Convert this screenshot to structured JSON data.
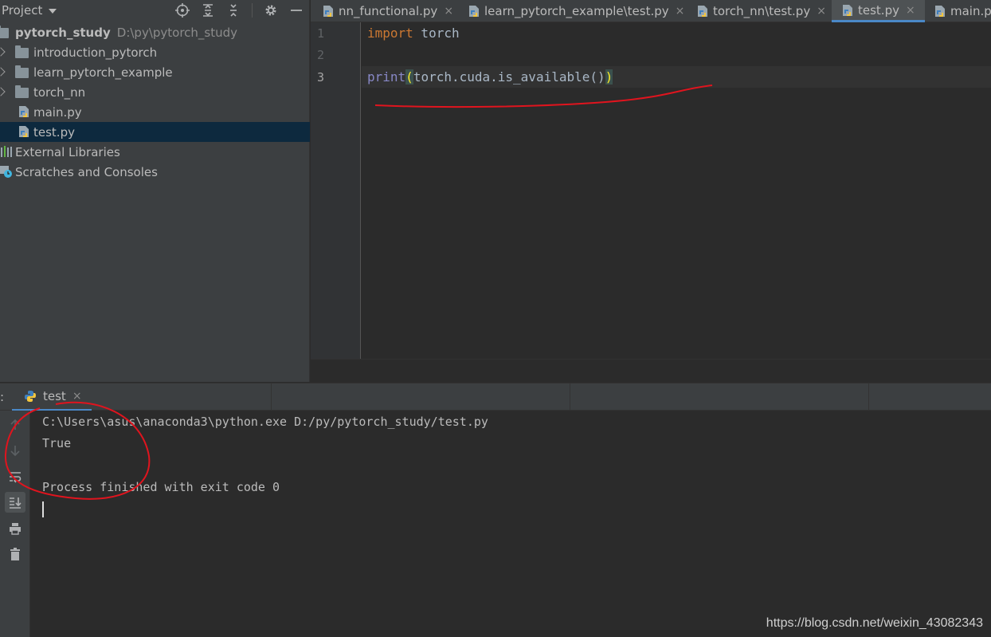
{
  "project": {
    "title": "Project",
    "tree": [
      {
        "label": "pytorch_study",
        "path": "D:\\py\\pytorch_study",
        "kind": "folder"
      },
      {
        "label": "introduction_pytorch",
        "kind": "folder"
      },
      {
        "label": "learn_pytorch_example",
        "kind": "folder"
      },
      {
        "label": "torch_nn",
        "kind": "folder"
      },
      {
        "label": "main.py",
        "kind": "python-file"
      },
      {
        "label": "test.py",
        "kind": "python-file",
        "selected": true
      },
      {
        "label": "External Libraries",
        "kind": "libraries"
      },
      {
        "label": "Scratches and Consoles",
        "kind": "scratches"
      }
    ]
  },
  "tabs": [
    {
      "label": "nn_functional.py"
    },
    {
      "label": "learn_pytorch_example\\test.py"
    },
    {
      "label": "torch_nn\\test.py"
    },
    {
      "label": "test.py",
      "active": true
    },
    {
      "label": "main.py"
    }
  ],
  "editor": {
    "line_numbers": [
      "1",
      "2",
      "3"
    ],
    "line1": {
      "keyword": "import",
      "rest": " torch"
    },
    "line3": {
      "builtin": "print",
      "open_paren": "(",
      "body": "torch.cuda.is_available()",
      "close_paren": ")"
    }
  },
  "run": {
    "colon": ":",
    "tab_label": "test",
    "close_glyph": "×",
    "console_lines": [
      "C:\\Users\\asus\\anaconda3\\python.exe D:/py/pytorch_study/test.py",
      "True",
      "",
      "Process finished with exit code 0"
    ]
  },
  "watermark": "https://blog.csdn.net/weixin_43082343",
  "colors": {
    "accent": "#4a88c7",
    "keyword": "#cc7832",
    "builtin": "#8888c6",
    "annotation": "#e0141e",
    "selection": "#0d293e"
  }
}
